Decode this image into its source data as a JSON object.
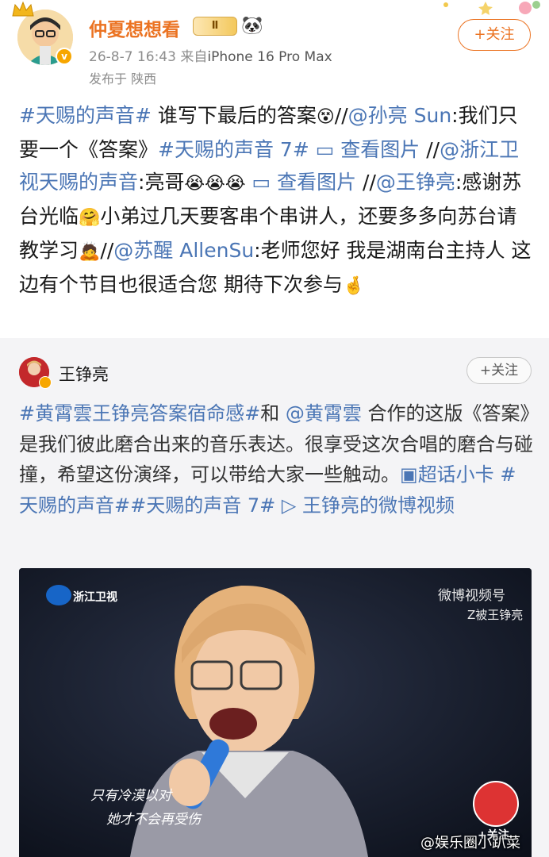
{
  "post": {
    "username": "仲夏想想看",
    "level_badge": "Ⅱ",
    "timestamp": "26-8-7 16:43",
    "source_prefix": "来自",
    "device": "iPhone 16 Pro Max",
    "location": "发布于 陕西",
    "follow_label": "+关注",
    "text": {
      "p1_tag": "#天赐的声音#",
      "p2": " 谁写下最后的答案",
      "p3_mark": "//",
      "p4_mention": "@孙亮 Sun",
      "p5": ":我们只要一个《答案》",
      "p6_tag": "#天赐的声音 7#",
      "p7_link": " 查看图片",
      "p8_mark": " //",
      "p9_mention": "@浙江卫视天赐的声音",
      "p10": ":亮哥",
      "p11_link": " 查看图片",
      "p12_mark": " //",
      "p13_mention": "@王铮亮",
      "p14": ":感谢苏台光临",
      "p15": "小弟过几天要客串个串讲人，还要多多向苏台请教学习",
      "p16_mark": "//",
      "p17_mention": "@苏醒 AllenSu",
      "p18": ":老师您好 我是湖南台主持人 这边有个节目也很适合您 期待下次参与"
    }
  },
  "repost": {
    "name": "王铮亮",
    "follow_label": "+关注",
    "text": {
      "t1_tag": "#黄霄雲王铮亮答案宿命感#",
      "t2": "和 ",
      "t3_mention": "@黄霄雲",
      "t4": " 合作的这版《答案》是我们彼此磨合出来的音乐表达。很享受这次合唱的磨合与碰撞，希望这份演绎，可以带给大家一些触动。",
      "t5_link": "超话小卡",
      "t6_tag": " #天赐的声音##天赐的声音 7#",
      "t7_link": " 王铮亮的微博视频"
    },
    "video": {
      "channel_logo": "浙江卫视",
      "brand": "微博视频号",
      "brand_sub": "Z被王铮亮",
      "subtitle1": "只有冷漠以对",
      "subtitle2": "她才不会再受伤",
      "mini_follow": "+关注"
    }
  },
  "watermark": "@娱乐圈小趴菜",
  "colors": {
    "accent_orange": "#eb7322",
    "link_blue": "#4b76b5",
    "card_bg": "#f4f4f6"
  }
}
